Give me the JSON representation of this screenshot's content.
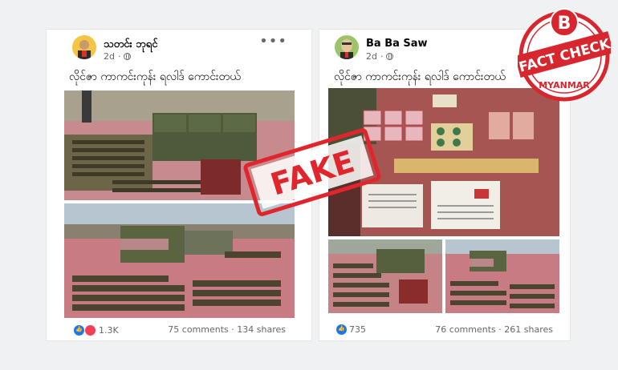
{
  "posts": [
    {
      "author": "သတင်း ဘုရင်",
      "time": "2d",
      "caption": "လိုင်ဇာ ကာကင်းကုန်း ရလါဒ် ကောင်းတယ်",
      "reaction_count": "1.3K",
      "comments": "75 comments",
      "shares": "134 shares",
      "more_label": "•••"
    },
    {
      "author": "Ba Ba Saw",
      "time": "2d",
      "caption": "လိုင်ဇာ ကာကင်းကုန်း ရလါဒ် ကောင်းတယ်",
      "reaction_count": "735",
      "comments": "76 comments",
      "shares": "261 shares"
    }
  ],
  "stamp": {
    "text": "FAKE",
    "color": "#e0262c"
  },
  "badge": {
    "letter": "B",
    "line1": "FACT CHECK",
    "line2": "MYANMAR",
    "color": "#d7262d"
  },
  "colors": {
    "facebook_blue": "#1877f2",
    "love_red": "#f33e58"
  }
}
